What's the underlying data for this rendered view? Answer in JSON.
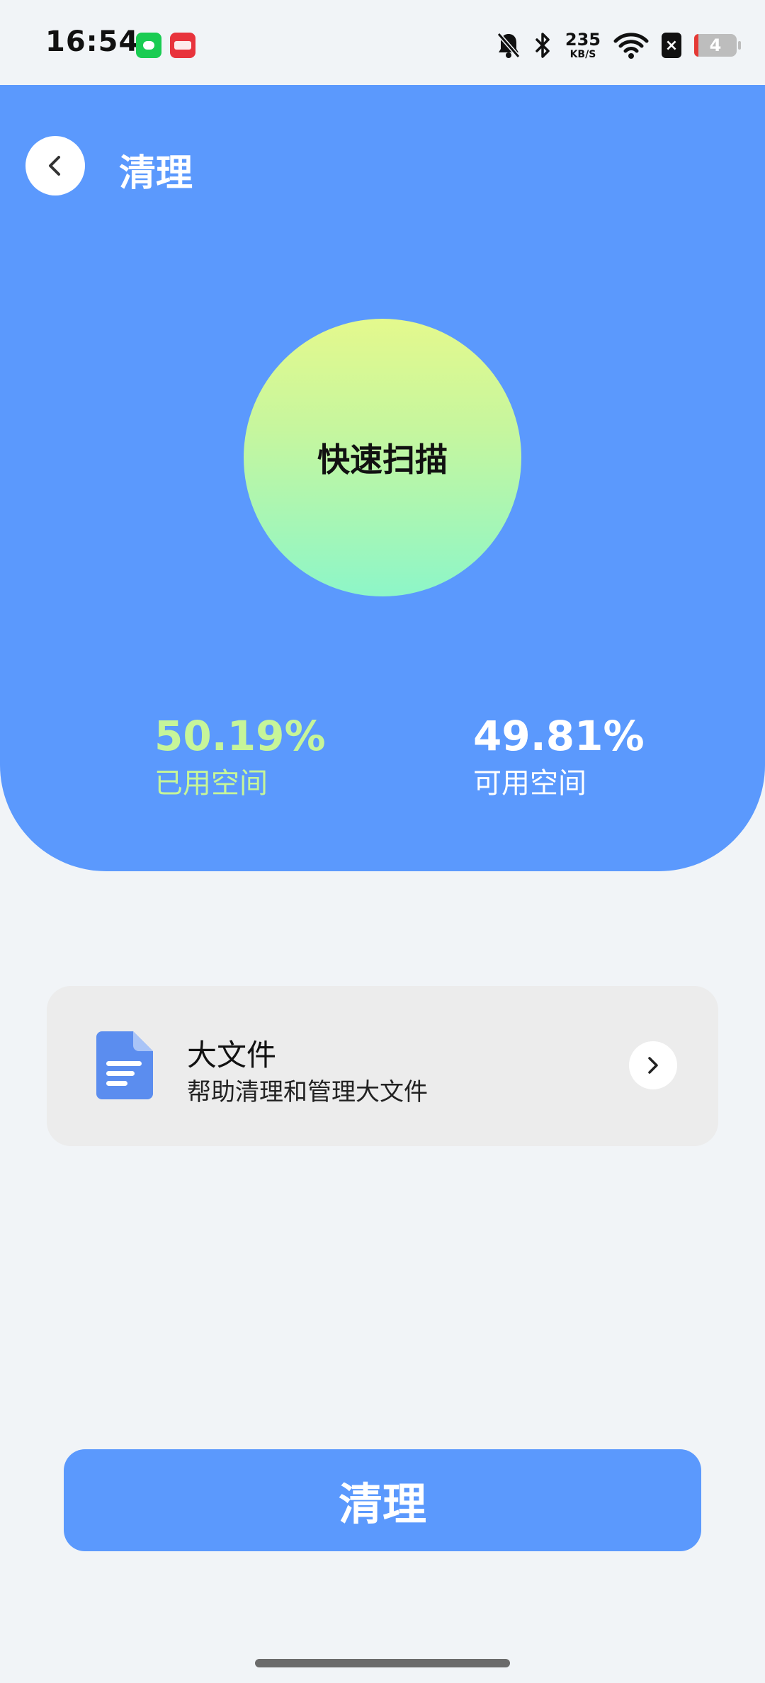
{
  "status_bar": {
    "time": "16:54",
    "notification_apps": [
      "wechat-app-icon",
      "xiaohongshu-app-icon"
    ],
    "net_speed_value": "235",
    "net_speed_unit": "KB/S",
    "close_box": "×",
    "battery_level": "4"
  },
  "header": {
    "title": "清理",
    "back_icon": "chevron-left-icon"
  },
  "scan": {
    "label": "快速扫描"
  },
  "storage": {
    "used_value": "50.19%",
    "used_label": "已用空间",
    "free_value": "49.81%",
    "free_label": "可用空间"
  },
  "big_file_card": {
    "title": "大文件",
    "subtitle": "帮助清理和管理大文件",
    "icon": "document-icon"
  },
  "actions": {
    "clean_label": "清理"
  },
  "colors": {
    "primary": "#5B99FD",
    "used_accent": "#C6F599",
    "background": "#F1F4F7",
    "card": "#ECECEC"
  }
}
